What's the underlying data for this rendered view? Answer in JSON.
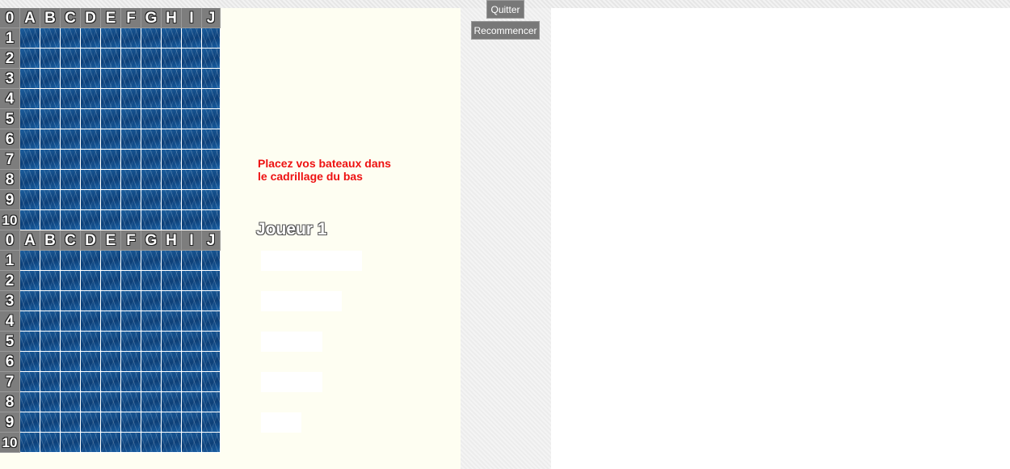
{
  "grid": {
    "corner_label": "0",
    "columns": [
      "A",
      "B",
      "C",
      "D",
      "E",
      "F",
      "G",
      "H",
      "I",
      "J"
    ],
    "rows": [
      "1",
      "2",
      "3",
      "4",
      "5",
      "6",
      "7",
      "8",
      "9",
      "10"
    ]
  },
  "message": {
    "line1": "Placez vos bateaux dans",
    "line2": "le cadrillage du bas"
  },
  "player_label": "Joueur 1",
  "ships": [
    {
      "name": "ship-5",
      "size": 5
    },
    {
      "name": "ship-4",
      "size": 4
    },
    {
      "name": "ship-3a",
      "size": 3
    },
    {
      "name": "ship-3b",
      "size": 3
    },
    {
      "name": "ship-2",
      "size": 2
    }
  ],
  "buttons": {
    "quit": "Quitter",
    "restart": "Recommencer"
  },
  "colors": {
    "message": "#ee1111",
    "header_bg": "#7d7d7d",
    "water": "#0c3f78",
    "panel_bg": "#fefef2"
  }
}
